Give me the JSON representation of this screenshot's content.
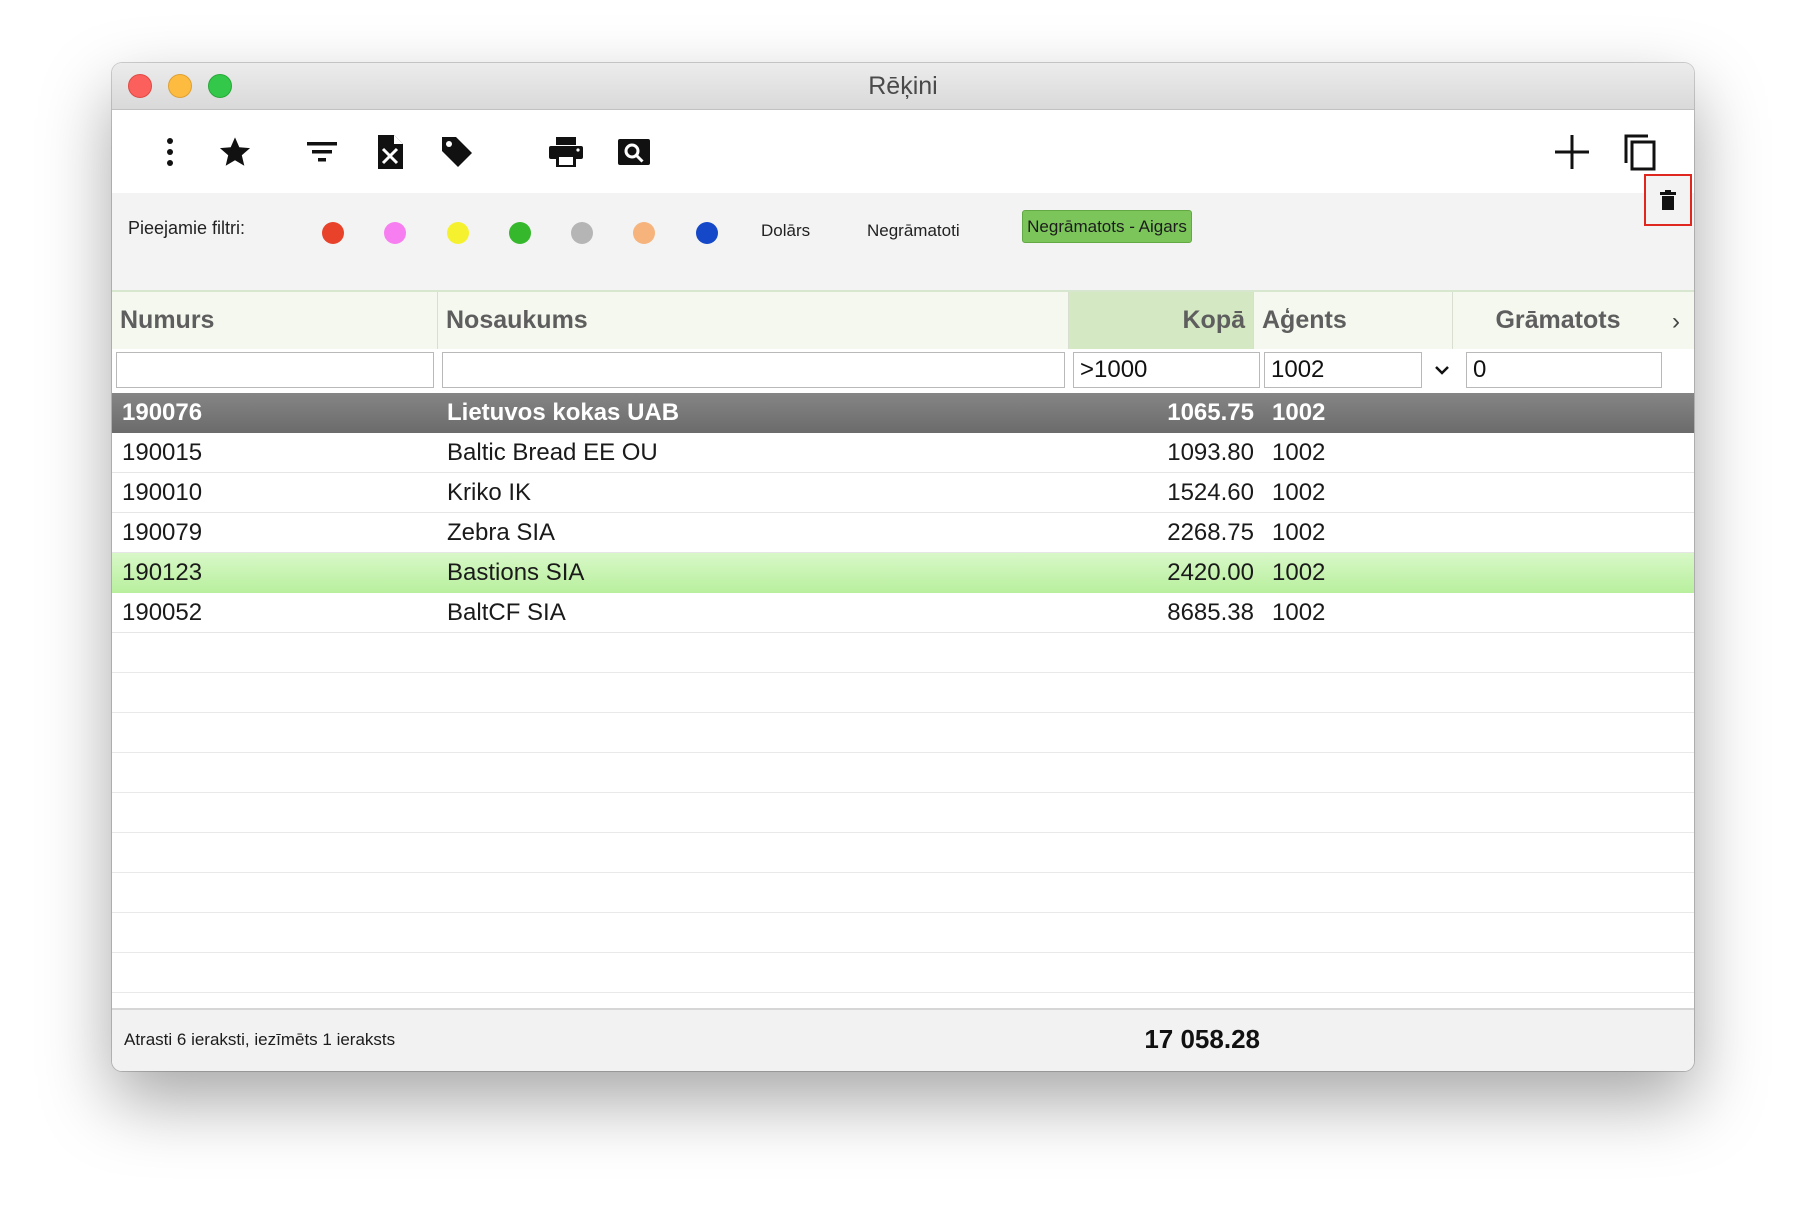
{
  "window": {
    "title": "Rēķini"
  },
  "toolbar": {
    "icons": [
      "more-vertical-icon",
      "star-icon",
      "filter-icon",
      "excel-export-icon",
      "tag-icon",
      "print-icon",
      "search-preview-icon",
      "add-icon",
      "copy-icon"
    ]
  },
  "filters": {
    "label": "Pieejamie filtri:",
    "colors": [
      "#e8422b",
      "#f77ef0",
      "#f5f12e",
      "#36b82c",
      "#b5b5b5",
      "#f6b37c",
      "#1448c8"
    ],
    "chip_dollars": "Dolārs",
    "chip_unbooked": "Negrāmatoti",
    "chip_active": "Negrāmatots - Aigars"
  },
  "table": {
    "columns": {
      "number": "Numurs",
      "name": "Nosaukums",
      "total": "Kopā",
      "agent": "Aģents",
      "booked": "Grāmatots"
    },
    "filter_values": {
      "number": "",
      "name": "",
      "total": ">1000",
      "agent": "1002",
      "booked": "0"
    },
    "rows": [
      {
        "number": "190076",
        "name": "Lietuvos kokas UAB",
        "total": "1065.75",
        "agent": "1002",
        "state": "selected"
      },
      {
        "number": "190015",
        "name": "Baltic Bread EE OU",
        "total": "1093.80",
        "agent": "1002",
        "state": "normal"
      },
      {
        "number": "190010",
        "name": "Kriko IK",
        "total": "1524.60",
        "agent": "1002",
        "state": "normal"
      },
      {
        "number": "190079",
        "name": "Zebra SIA",
        "total": "2268.75",
        "agent": "1002",
        "state": "normal"
      },
      {
        "number": "190123",
        "name": "Bastions SIA",
        "total": "2420.00",
        "agent": "1002",
        "state": "highlight"
      },
      {
        "number": "190052",
        "name": "BaltCF SIA",
        "total": "8685.38",
        "agent": "1002",
        "state": "normal"
      }
    ]
  },
  "status": {
    "text": "Atrasti 6 ieraksti, iezīmēts 1 ieraksts",
    "total": "17 058.28"
  }
}
